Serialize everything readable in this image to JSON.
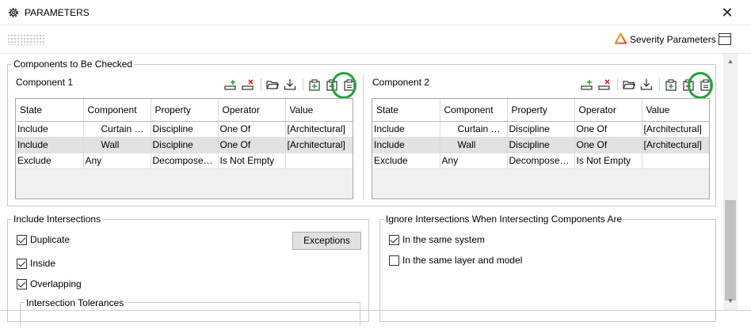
{
  "window": {
    "title": "PARAMETERS",
    "icon": "gear-icon",
    "close_icon": "close-icon",
    "close_glyph": "✕"
  },
  "toolbar": {
    "severity_label": "Severity Parameters",
    "severity_icon": "warning-triangle-icon",
    "panel_icon": "panel-layout-icon"
  },
  "components_group": {
    "label": "Components to Be Checked",
    "components": [
      {
        "title": "Component 1",
        "columns": [
          "State",
          "Component",
          "Property",
          "Operator",
          "Value"
        ],
        "rows": [
          [
            "Include",
            "Curtain W...",
            "Discipline",
            "One Of",
            "[Architectural]"
          ],
          [
            "Include",
            "Wall",
            "Discipline",
            "One Of",
            "[Architectural]"
          ],
          [
            "Exclude",
            "Any",
            "Decomposes ...",
            "Is Not Empty",
            ""
          ]
        ],
        "selected_row": 1
      },
      {
        "title": "Component 2",
        "columns": [
          "State",
          "Component",
          "Property",
          "Operator",
          "Value"
        ],
        "rows": [
          [
            "Include",
            "Curtain W...",
            "Discipline",
            "One Of",
            "[Architectural]"
          ],
          [
            "Include",
            "Wall",
            "Discipline",
            "One Of",
            "[Architectural]"
          ],
          [
            "Exclude",
            "Any",
            "Decomposes ...",
            "Is Not Empty",
            ""
          ]
        ],
        "selected_row": 1
      }
    ],
    "toolbar_icons": [
      "add-row-icon",
      "delete-row-icon",
      "open-folder-icon",
      "download-icon",
      "add-criteria-icon",
      "remove-criteria-icon",
      "clipboard-icon"
    ],
    "highlight_color": "#1fa33a"
  },
  "include_group": {
    "label": "Include Intersections",
    "options": [
      {
        "label": "Duplicate",
        "checked": true
      },
      {
        "label": "Inside",
        "checked": true
      },
      {
        "label": "Overlapping",
        "checked": true
      }
    ],
    "exceptions_label": "Exceptions",
    "tolerances_label": "Intersection Tolerances"
  },
  "ignore_group": {
    "label": "Ignore Intersections When Intersecting Components Are",
    "options": [
      {
        "label": "In the same system",
        "checked": true
      },
      {
        "label": "In the same layer and model",
        "checked": false
      }
    ]
  }
}
